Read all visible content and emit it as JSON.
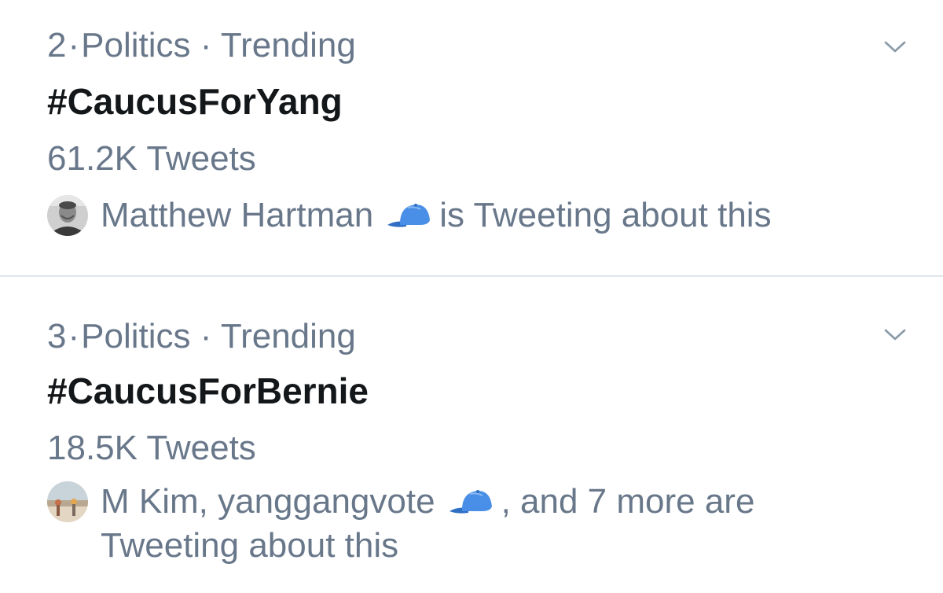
{
  "trends": [
    {
      "rank": "2",
      "category": "Politics",
      "status": "Trending",
      "separator": "·",
      "hashtag": "#CaucusForYang",
      "tweet_count": "61.2K Tweets",
      "context_names": "Matthew Hartman",
      "context_suffix": "is Tweeting about this",
      "avatar_icon": "person-avatar",
      "emoji_icon": "blue-baseball-cap-icon"
    },
    {
      "rank": "3",
      "category": "Politics",
      "status": "Trending",
      "separator": "·",
      "hashtag": "#CaucusForBernie",
      "tweet_count": "18.5K Tweets",
      "context_names": "M Kim, yanggangvote",
      "context_suffix": ", and 7 more are Tweeting about this",
      "avatar_icon": "beach-scene-avatar",
      "emoji_icon": "blue-baseball-cap-icon"
    }
  ],
  "colors": {
    "secondary_text": "#68778a",
    "primary_text": "#14171a",
    "divider": "#e1e6ea",
    "cap_blue": "#4a8fe7"
  }
}
